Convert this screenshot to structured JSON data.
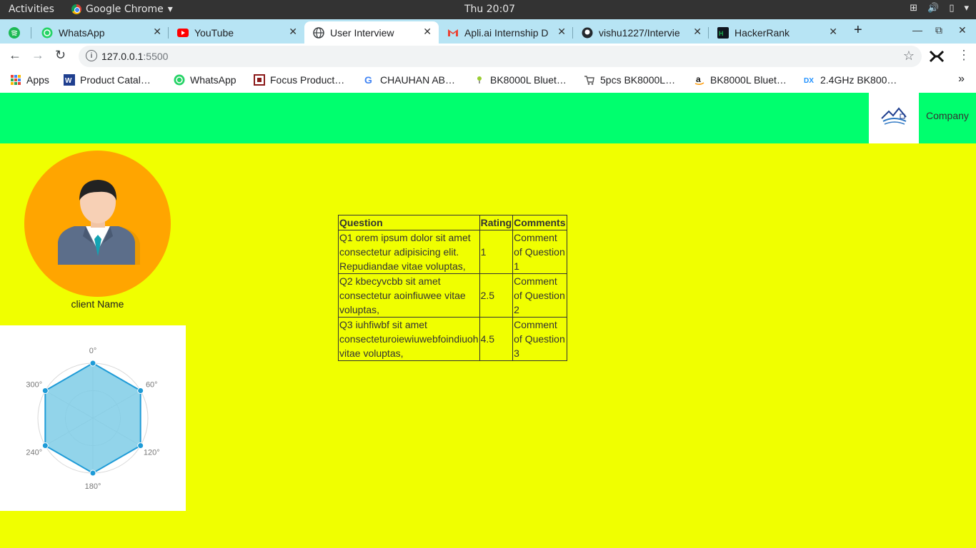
{
  "system": {
    "activities": "Activities",
    "app_name": "Google Chrome",
    "clock": "Thu 20:07"
  },
  "tabs": [
    {
      "label": "",
      "icon": "spotify-icon"
    },
    {
      "label": "WhatsApp",
      "icon": "whatsapp-icon"
    },
    {
      "label": "YouTube",
      "icon": "youtube-icon"
    },
    {
      "label": "User Interview",
      "icon": "globe-icon",
      "active": true
    },
    {
      "label": "Apli.ai Internship D",
      "icon": "gmail-icon"
    },
    {
      "label": "vishu1227/Intervie",
      "icon": "github-icon"
    },
    {
      "label": "HackerRank",
      "icon": "hackerrank-icon"
    }
  ],
  "address": {
    "host": "127.0.0.1",
    "port": ":5500"
  },
  "bookmarks": [
    {
      "label": "Apps",
      "icon": "apps-grid-icon"
    },
    {
      "label": "Product Catal…",
      "icon": "w-icon"
    },
    {
      "label": "WhatsApp",
      "icon": "whatsapp-icon"
    },
    {
      "label": "Focus Product…",
      "icon": "focus-icon"
    },
    {
      "label": "CHAUHAN AB…",
      "icon": "google-icon"
    },
    {
      "label": "BK8000L Bluet…",
      "icon": "bulb-icon"
    },
    {
      "label": "5pcs BK8000L…",
      "icon": "cart-icon"
    },
    {
      "label": "BK8000L Bluet…",
      "icon": "amazon-icon"
    },
    {
      "label": "2.4GHz BK800…",
      "icon": "dx-icon"
    }
  ],
  "page": {
    "company": "Company",
    "client_name": "client Name",
    "colors": {
      "header": "#00ff6e",
      "body": "#f0ff00",
      "avatar_bg": "#ffa500",
      "radar_fill": "#7fcce6",
      "radar_stroke": "#1e9bd7"
    }
  },
  "table": {
    "headers": [
      "Question",
      "Rating",
      "Comments"
    ],
    "rows": [
      {
        "question": "Q1 orem ipsum dolor sit amet consectetur adipisicing elit. Repudiandae vitae voluptas,",
        "rating": "1",
        "comment": "Comment of Question 1"
      },
      {
        "question": "Q2 kbecyvcbb sit amet consectetur aoinfiuwee vitae voluptas,",
        "rating": "2.5",
        "comment": "Comment of Question 2"
      },
      {
        "question": "Q3 iuhfiwbf sit amet consecteturoiewiuwebfoindiuoh vitae voluptas,",
        "rating": "4.5",
        "comment": "Comment of Question 3"
      }
    ]
  },
  "chart_data": {
    "type": "radar",
    "categories": [
      "0°",
      "60°",
      "120°",
      "180°",
      "240°",
      "300°"
    ],
    "values": [
      1,
      1,
      1,
      1,
      1,
      1
    ],
    "rlim": [
      0,
      1
    ]
  }
}
